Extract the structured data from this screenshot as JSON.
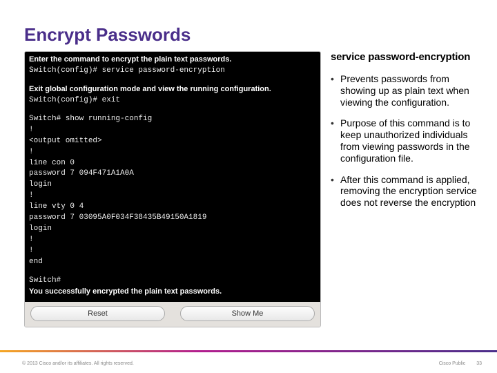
{
  "title": "Encrypt Passwords",
  "terminal": {
    "instr1": "Enter the command to encrypt the plain text passwords.",
    "line1": "Switch(config)# service password-encryption",
    "instr2": "Exit global configuration mode and view the running configuration.",
    "line2": "Switch(config)# exit",
    "line3": "Switch# show running-config",
    "line4": "!",
    "line5": "<output omitted>",
    "line6": "!",
    "line7": "line con 0",
    "line8": " password 7 094F471A1A0A",
    "line9": " login",
    "line10": "!",
    "line11": "line vty 0 4",
    "line12": " password 7 03095A0F034F38435B49150A1819",
    "line13": " login",
    "line14": "!",
    "line15": "!",
    "line16": "end",
    "line17": "Switch#",
    "instr3": "You successfully encrypted the plain text passwords."
  },
  "buttons": {
    "reset": "Reset",
    "showme": "Show Me"
  },
  "right": {
    "heading": "service password-encryption",
    "b1": "Prevents passwords from showing up as plain text when viewing the configuration.",
    "b2": "Purpose of this command is to keep unauthorized individuals from viewing passwords in the configuration file.",
    "b3": "After this command is applied, removing the encryption service does not reverse the encryption"
  },
  "footer": {
    "left": "© 2013 Cisco and/or its affiliates. All rights reserved.",
    "right": "Cisco Public",
    "page": "33"
  }
}
